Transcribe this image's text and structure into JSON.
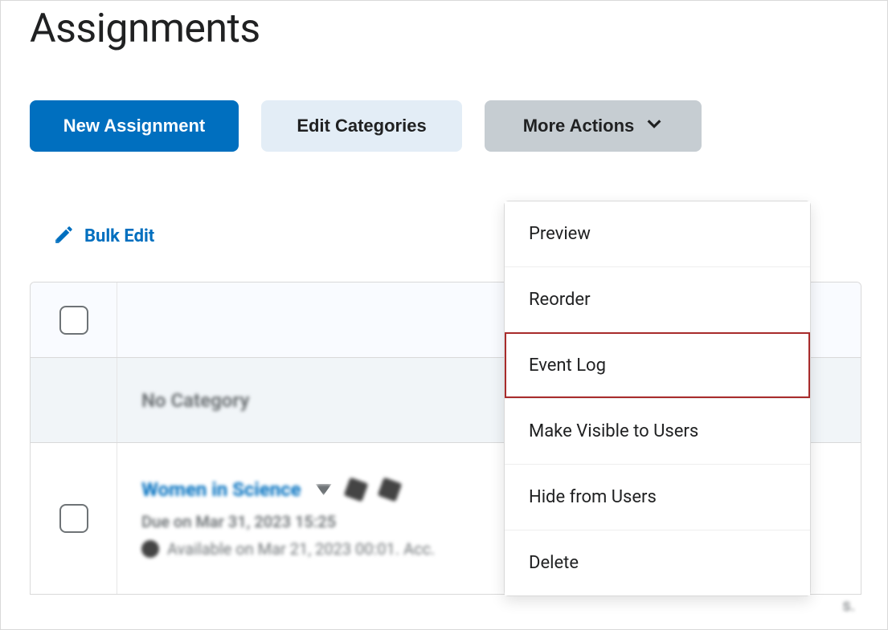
{
  "page": {
    "title": "Assignments"
  },
  "toolbar": {
    "new_assignment": "New Assignment",
    "edit_categories": "Edit Categories",
    "more_actions": "More Actions"
  },
  "bulk_edit": "Bulk Edit",
  "dropdown": {
    "items": [
      "Preview",
      "Reorder",
      "Event Log",
      "Make Visible to Users",
      "Hide from Users",
      "Delete"
    ],
    "highlighted_index": 2
  },
  "table": {
    "category_label": "No Category",
    "assignment": {
      "title": "Women in Science",
      "due_text": "Due on Mar 31, 2023 15:25",
      "availability_text": "Available on Mar 21, 2023 00:01. Acc.",
      "availability_trail": "s."
    }
  }
}
